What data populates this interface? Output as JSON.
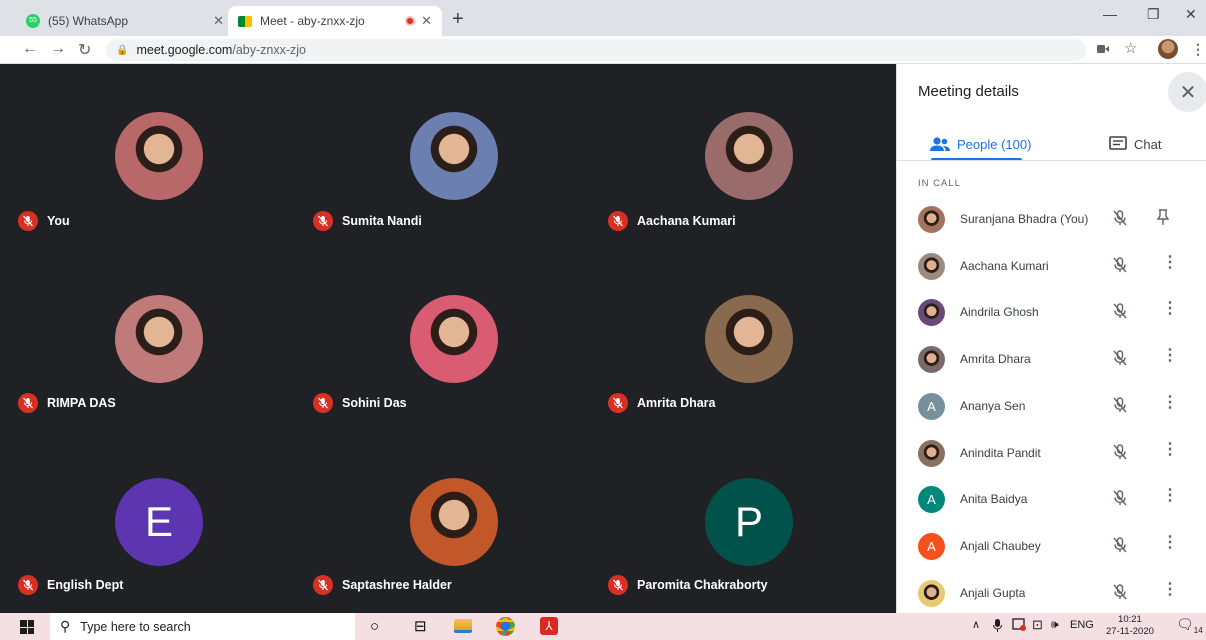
{
  "browser": {
    "tabs": [
      {
        "title": "(55) WhatsApp",
        "badge": "55",
        "active": false
      },
      {
        "title": "Meet - aby-znxx-zjo",
        "active": true
      }
    ],
    "url_host": "meet.google.com",
    "url_path": "/aby-znxx-zjo"
  },
  "colors": {
    "accent": "#1a73e8",
    "muted": "#d93025",
    "stage": "#202124"
  },
  "participants": [
    {
      "name": "You",
      "avatar": "photo",
      "color": "#b9686a"
    },
    {
      "name": "Sumita Nandi",
      "avatar": "photo",
      "color": "#6b7fb0"
    },
    {
      "name": "Aachana Kumari",
      "avatar": "photo",
      "color": "#9a6b6b"
    },
    {
      "name": "RIMPA DAS",
      "avatar": "photo",
      "color": "#c07a7a"
    },
    {
      "name": "Sohini Das",
      "avatar": "photo",
      "color": "#d95c73"
    },
    {
      "name": "Amrita Dhara",
      "avatar": "photo",
      "color": "#8a6a4f"
    },
    {
      "name": "English Dept",
      "avatar": "initial",
      "initial": "E",
      "color": "#5e35b1"
    },
    {
      "name": "Saptashree Halder",
      "avatar": "photo",
      "color": "#c2572a"
    },
    {
      "name": "Paromita Chakraborty",
      "avatar": "initial",
      "initial": "P",
      "color": "#00524a"
    }
  ],
  "panel": {
    "title": "Meeting details",
    "people_tab": "People (100)",
    "chat_tab": "Chat",
    "section": "IN CALL",
    "people": [
      {
        "name": "Suranjana Bhadra (You)",
        "avatar": "photo",
        "color": "#a47360",
        "action": "pin"
      },
      {
        "name": "Aachana Kumari",
        "avatar": "photo",
        "color": "#9a8a80",
        "action": "more"
      },
      {
        "name": "Aindrila Ghosh",
        "avatar": "photo",
        "color": "#6a4a7a",
        "action": "more"
      },
      {
        "name": "Amrita Dhara",
        "avatar": "photo",
        "color": "#7a6a6a",
        "action": "more"
      },
      {
        "name": "Ananya Sen",
        "avatar": "initial",
        "initial": "A",
        "color": "#78909c",
        "action": "more"
      },
      {
        "name": "Anindita Pandit",
        "avatar": "photo",
        "color": "#8a7060",
        "action": "more"
      },
      {
        "name": "Anita Baidya",
        "avatar": "initial",
        "initial": "A",
        "color": "#00897b",
        "action": "more"
      },
      {
        "name": "Anjali Chaubey",
        "avatar": "initial",
        "initial": "A",
        "color": "#f4511e",
        "action": "more"
      },
      {
        "name": "Anjali Gupta",
        "avatar": "photo",
        "color": "#e8c870",
        "action": "more"
      }
    ]
  },
  "taskbar": {
    "search_placeholder": "Type here to search",
    "lang": "ENG",
    "time": "10:21",
    "date": "27-11-2020",
    "notifications": "14"
  }
}
